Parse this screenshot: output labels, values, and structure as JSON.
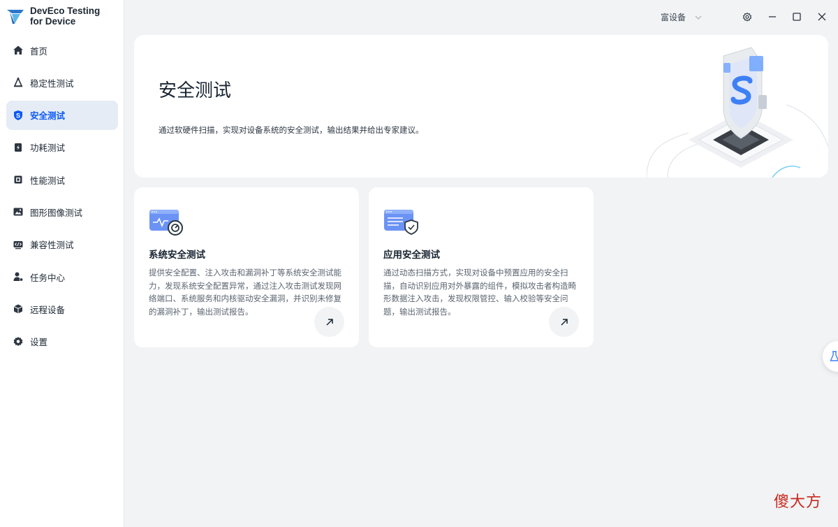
{
  "app": {
    "name_line1": "DevEco Testing",
    "name_line2": "for Device"
  },
  "sidebar": {
    "items": [
      {
        "label": "首页",
        "icon": "home-icon"
      },
      {
        "label": "稳定性测试",
        "icon": "stability-icon"
      },
      {
        "label": "安全测试",
        "icon": "shield-icon",
        "active": true
      },
      {
        "label": "功耗测试",
        "icon": "power-icon"
      },
      {
        "label": "性能测试",
        "icon": "chip-icon"
      },
      {
        "label": "图形图像测试",
        "icon": "image-icon"
      },
      {
        "label": "兼容性测试",
        "icon": "compat-icon"
      },
      {
        "label": "任务中心",
        "icon": "task-icon"
      },
      {
        "label": "远程设备",
        "icon": "cube-icon"
      },
      {
        "label": "设置",
        "icon": "gear-icon"
      }
    ]
  },
  "titlebar": {
    "device_select": "富设备"
  },
  "hero": {
    "title": "安全测试",
    "description": "通过软硬件扫描，实现对设备系统的安全测试，输出结果并给出专家建议。"
  },
  "cards": [
    {
      "title": "系统安全测试",
      "description": "提供安全配置、注入攻击和漏洞补丁等系统安全测试能力，发现系统安全配置异常，通过注入攻击测试发现网络端口、系统服务和内核驱动安全漏洞，并识别未修复的漏洞补丁，输出测试报告。"
    },
    {
      "title": "应用安全测试",
      "description": "通过动态扫描方式，实现对设备中预置应用的安全扫描，自动识别应用对外暴露的组件，模拟攻击者构造畸形数据注入攻击，发现权限管控、输入校验等安全问题，输出测试报告。"
    }
  ],
  "watermark": "傻大方",
  "colors": {
    "accent": "#0a59f7",
    "active_bg": "#e6ecf6",
    "page_bg": "#f1f3f5"
  }
}
